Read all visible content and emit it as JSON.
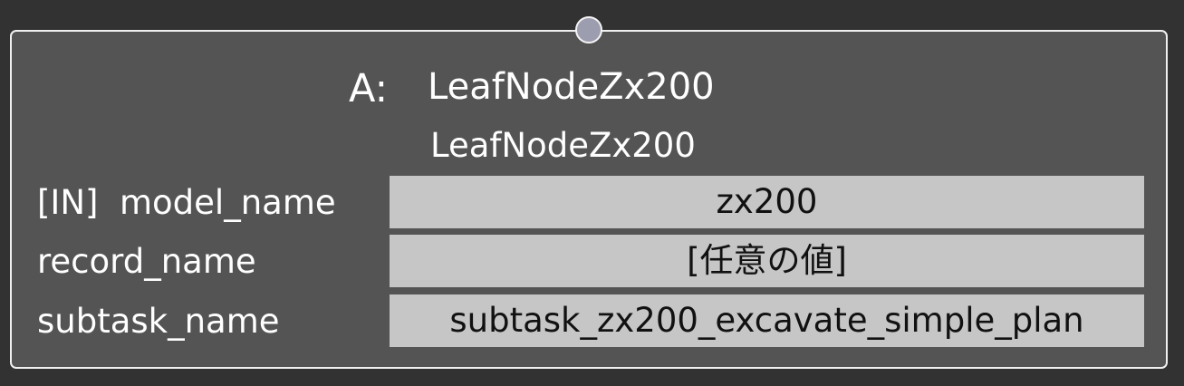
{
  "node": {
    "type_prefix": "A:",
    "type_name": "LeafNodeZx200",
    "instance_name": "LeafNodeZx200",
    "ports": [
      {
        "label": "[IN]  model_name",
        "value": "zx200"
      },
      {
        "label": "record_name",
        "value": "[任意の値]"
      },
      {
        "label": "subtask_name",
        "value": "subtask_zx200_excavate_simple_plan"
      }
    ]
  },
  "colors": {
    "canvas_background": "#323232",
    "node_background": "#545454",
    "node_border": "#f0f0f0",
    "input_port": "#9d9db0",
    "value_field": "#c6c6c6"
  }
}
